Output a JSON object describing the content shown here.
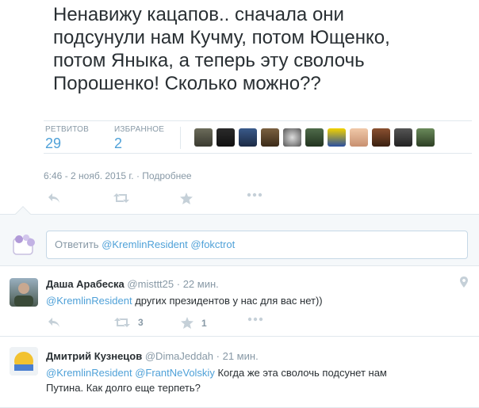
{
  "tweet": {
    "text": "Ненавижу кацапов.. сначала они\nподсунули нам Кучму, потом Ющенко,\nпотом Яныка, а теперь эту сволочь\nПорошенко! Сколько можно??",
    "retweets_label": "РЕТВИТОВ",
    "retweets_count": "29",
    "favorites_label": "ИЗБРАННОЕ",
    "favorites_count": "2",
    "timestamp": "6:46 - 2 нояб. 2015 г. · Подробнее"
  },
  "reply_box": {
    "prefix": "Ответить ",
    "mention1": "@KremlinResident",
    "mention2": "@fokctrot"
  },
  "replies": [
    {
      "name": "Даша Арабеска",
      "username": "@misttt25",
      "time": "· 22 мин.",
      "mention1": "@KremlinResident",
      "text": " других президентов у нас для вас нет))",
      "retweet_count": "3",
      "favorite_count": "1"
    },
    {
      "name": "Дмитрий Кузнецов",
      "username": "@DimaJeddah",
      "time": "· 21 мин.",
      "mention1": "@KremlinResident",
      "mention2": "@FrantNeVolskiy",
      "text": " Когда же эта сволочь подсунет нам",
      "text2": "Путина. Как долго еще терпеть?"
    }
  ],
  "colors": {
    "link": "#4fa1d8",
    "muted": "#8899a6",
    "icon": "#aab8c2"
  },
  "icons": [
    "reply-icon",
    "retweet-icon",
    "favorite-icon",
    "more-icon",
    "location-pin-icon"
  ]
}
